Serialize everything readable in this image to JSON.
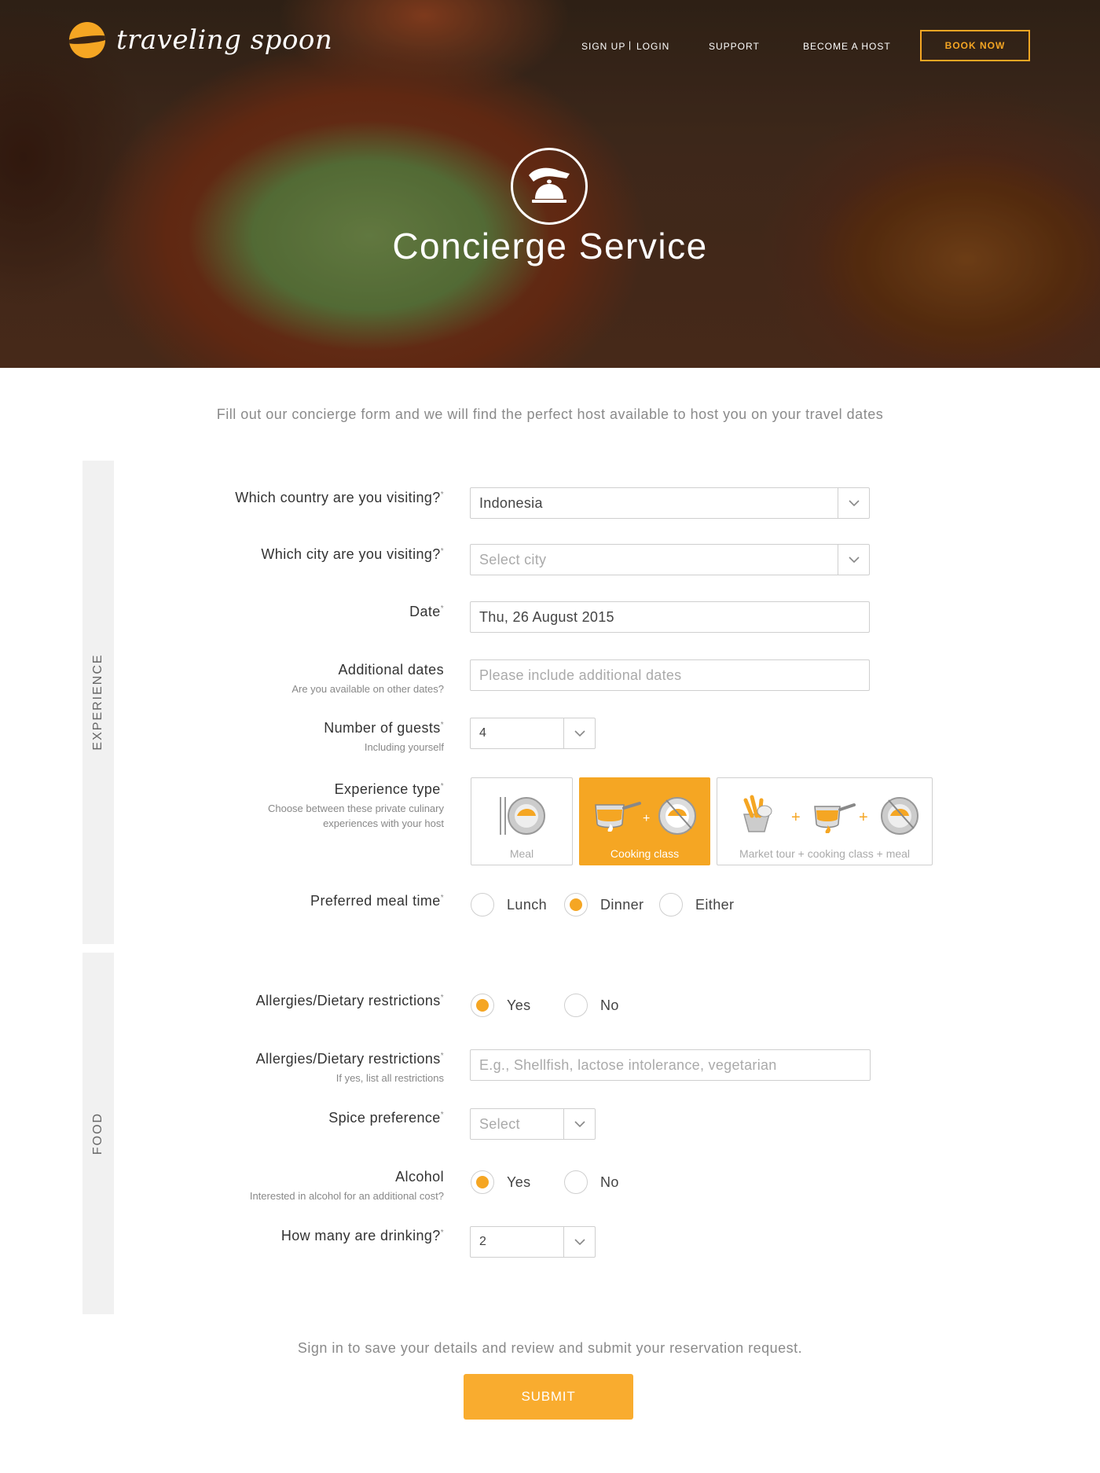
{
  "brand": {
    "name": "traveling spoon"
  },
  "nav": {
    "signup": "SIGN UP",
    "separator": "|",
    "login": "LOGIN",
    "support": "SUPPORT",
    "become_host": "BECOME A HOST",
    "book_now": "BOOK NOW"
  },
  "hero": {
    "title": "Concierge Service",
    "icon": "concierge-bell-icon"
  },
  "intro": "Fill out our concierge form and we will find the perfect host available to host you on your travel dates",
  "sections": {
    "experience": "EXPERIENCE",
    "food": "FOOD"
  },
  "form": {
    "country": {
      "label": "Which country are you visiting?",
      "required": "*",
      "value": "Indonesia"
    },
    "city": {
      "label": "Which city are you visiting?",
      "required": "*",
      "placeholder": "Select city"
    },
    "date": {
      "label": "Date",
      "required": "*",
      "value": "Thu, 26 August 2015"
    },
    "additional_dates": {
      "label": "Additional dates",
      "sub": "Are you available on other dates?",
      "placeholder": "Please include additional dates"
    },
    "guests": {
      "label": "Number of guests",
      "required": "*",
      "sub": "Including yourself",
      "value": "4"
    },
    "experience_type": {
      "label": "Experience type",
      "required": "*",
      "sub_line1": "Choose between these private culinary",
      "sub_line2": "experiences with your host",
      "options": [
        "Meal",
        "Cooking class",
        "Market tour + cooking class + meal"
      ],
      "selected": "Cooking class"
    },
    "meal_time": {
      "label": "Preferred meal time",
      "required": "*",
      "options": [
        "Lunch",
        "Dinner",
        "Either"
      ],
      "selected": "Dinner"
    },
    "allergies": {
      "label": "Allergies/Dietary restrictions",
      "required": "*",
      "options": [
        "Yes",
        "No"
      ],
      "selected": "Yes"
    },
    "allergies_list": {
      "label": "Allergies/Dietary restrictions",
      "required": "*",
      "sub": "If yes, list all restrictions",
      "placeholder": "E.g., Shellfish, lactose intolerance, vegetarian"
    },
    "spice": {
      "label": "Spice preference",
      "required": "*",
      "placeholder": "Select"
    },
    "alcohol": {
      "label": "Alcohol",
      "sub": "Interested in alcohol for an additional cost?",
      "options": [
        "Yes",
        "No"
      ],
      "selected": "Yes"
    },
    "drinking": {
      "label": "How many are drinking?",
      "required": "*",
      "value": "2"
    }
  },
  "footer": {
    "note": "Sign in to save your details and review and submit your reservation request.",
    "submit": "SUBMIT"
  },
  "colors": {
    "accent": "#f5a623",
    "text": "#444444",
    "muted": "#8a8a8a",
    "border": "#cfcfcf"
  }
}
